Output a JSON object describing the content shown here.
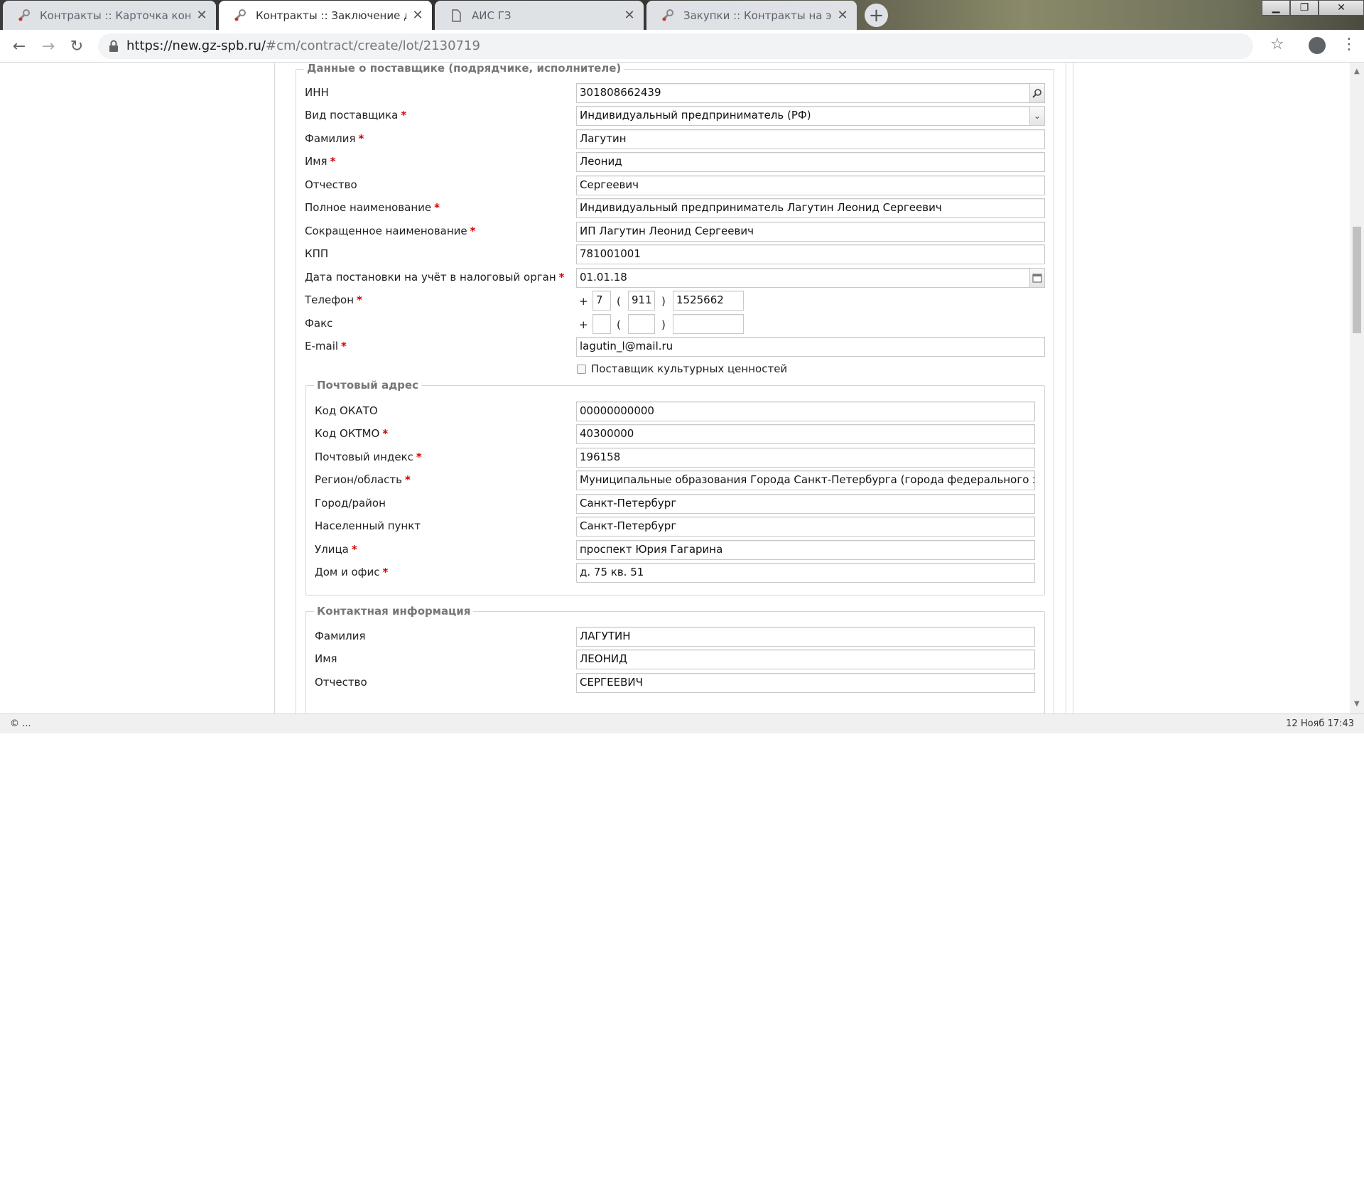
{
  "browser": {
    "tabs": [
      {
        "title": "Контракты :: Карточка контракта",
        "active": false
      },
      {
        "title": "Контракты :: Заключение договора",
        "active": true
      },
      {
        "title": "АИС ГЗ",
        "active": false
      },
      {
        "title": "Закупки :: Контракты на этапе исполнения",
        "active": false
      }
    ],
    "url_host": "https://new.gz-spb.ru/",
    "url_path": "#cm/contract/create/lot/2130719"
  },
  "supplier": {
    "legend": "Данные о поставщике (подрядчике, исполнителе)",
    "inn_label": "ИНН",
    "inn_value": "301808662439",
    "type_label": "Вид поставщика",
    "type_value": "Индивидуальный предприниматель (РФ)",
    "lastname_label": "Фамилия",
    "lastname_value": "Лагутин",
    "firstname_label": "Имя",
    "firstname_value": "Леонид",
    "middlename_label": "Отчество",
    "middlename_value": "Сергеевич",
    "fullname_label": "Полное наименование",
    "fullname_value": "Индивидуальный предприниматель Лагутин Леонид Сергеевич",
    "shortname_label": "Сокращенное наименование",
    "shortname_value": "ИП Лагутин Леонид Сергеевич",
    "kpp_label": "КПП",
    "kpp_value": "781001001",
    "taxdate_label": "Дата постановки на учёт в налоговый орган",
    "taxdate_value": "01.01.18",
    "phone_label": "Телефон",
    "phone_country": "7",
    "phone_code": "911",
    "phone_number": "1525662",
    "fax_label": "Факс",
    "fax_country": "",
    "fax_code": "",
    "fax_number": "",
    "email_label": "E-mail",
    "email_value": "lagutin_l@mail.ru",
    "culture_label": "Поставщик культурных ценностей",
    "plus": "+",
    "paren_open": "(",
    "paren_close": ")",
    "req": "*"
  },
  "postal": {
    "legend": "Почтовый адрес",
    "okato_label": "Код ОКАТО",
    "okato_value": "00000000000",
    "oktmo_label": "Код ОКТМО",
    "oktmo_value": "40300000",
    "index_label": "Почтовый индекс",
    "index_value": "196158",
    "region_label": "Регион/область",
    "region_value": "Муниципальные образования Города Санкт-Петербурга (города федерального значения)",
    "city_label": "Город/район",
    "city_value": "Санкт-Петербург",
    "locality_label": "Населенный пункт",
    "locality_value": "Санкт-Петербург",
    "street_label": "Улица",
    "street_value": "проспект Юрия Гагарина",
    "house_label": "Дом и офис",
    "house_value": "д. 75 кв. 51"
  },
  "contact": {
    "legend": "Контактная информация",
    "lastname_label": "Фамилия",
    "lastname_value": "ЛАГУТИН",
    "firstname_label": "Имя",
    "firstname_value": "ЛЕОНИД",
    "middlename_label": "Отчество",
    "middlename_value": "СЕРГЕЕВИЧ"
  },
  "status": {
    "left": "© ...",
    "right": "12 Нояб 17:43"
  }
}
